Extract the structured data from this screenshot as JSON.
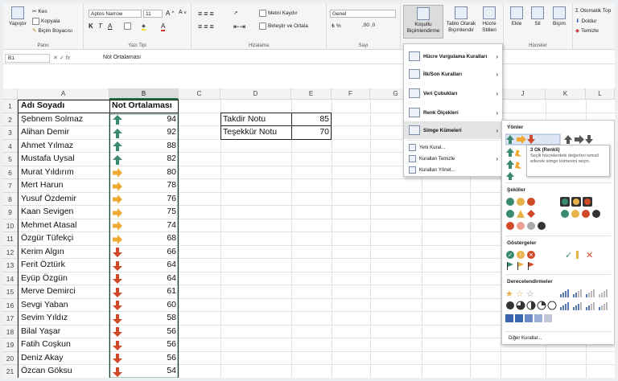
{
  "ribbon": {
    "clipboard": {
      "paste": "Yapıştır",
      "cut": "Kes",
      "copy": "Kopyala",
      "format_painter": "Biçim Boyacısı",
      "label": "Pano"
    },
    "font": {
      "name": "Aptos Narrow",
      "size": "11",
      "label": "Yazı Tipi",
      "bold": "K",
      "italic": "T",
      "underline": "A"
    },
    "alignment": {
      "wrap": "Metni Kaydır",
      "merge": "Birleştir ve Ortala",
      "label": "Hizalama"
    },
    "number": {
      "format": "Genel",
      "label": "Sayı"
    },
    "styles": {
      "conditional": "Koşullu Biçimlendirme",
      "table": "Tablo Olarak Biçimlendir",
      "cell": "Hücre Stilleri"
    },
    "cells": {
      "insert": "Ekle",
      "delete": "Sil",
      "format": "Biçim",
      "label": "Hücreler"
    },
    "editing": {
      "autosum": "Otomatik Top",
      "fill": "Doldur",
      "clear": "Temizle"
    }
  },
  "formula_bar": {
    "name_box": "B1",
    "fx": "fx",
    "content": "Not Ortalaması"
  },
  "columns": [
    "A",
    "B",
    "C",
    "D",
    "E",
    "F",
    "G",
    "H",
    "I",
    "J",
    "K",
    "L"
  ],
  "rows": [
    "1",
    "2",
    "3",
    "4",
    "5",
    "6",
    "7",
    "8",
    "9",
    "10",
    "11",
    "12",
    "13",
    "14",
    "15",
    "16",
    "17",
    "18",
    "19",
    "20",
    "21"
  ],
  "headers": {
    "name": "Adı Soyadı",
    "grade": "Not Ortalaması"
  },
  "students": [
    {
      "name": "Şebnem Solmaz",
      "grade": 94,
      "icon": "up"
    },
    {
      "name": "Alihan Demir",
      "grade": 92,
      "icon": "up"
    },
    {
      "name": "Ahmet Yılmaz",
      "grade": 88,
      "icon": "up"
    },
    {
      "name": "Mustafa Uysal",
      "grade": 82,
      "icon": "up"
    },
    {
      "name": "Murat Yıldırım",
      "grade": 80,
      "icon": "right"
    },
    {
      "name": "Mert Harun",
      "grade": 78,
      "icon": "right"
    },
    {
      "name": "Yusuf Özdemir",
      "grade": 76,
      "icon": "right"
    },
    {
      "name": "Kaan Sevigen",
      "grade": 75,
      "icon": "right"
    },
    {
      "name": "Mehmet Atasal",
      "grade": 74,
      "icon": "right"
    },
    {
      "name": "Özgür Tüfekçi",
      "grade": 68,
      "icon": "right"
    },
    {
      "name": "Kerim Algın",
      "grade": 66,
      "icon": "down"
    },
    {
      "name": "Ferit Öztürk",
      "grade": 64,
      "icon": "down"
    },
    {
      "name": "Eyüp Özgün",
      "grade": 64,
      "icon": "down"
    },
    {
      "name": "Merve Demirci",
      "grade": 61,
      "icon": "down"
    },
    {
      "name": "Sevgi Yaban",
      "grade": 60,
      "icon": "down"
    },
    {
      "name": "Sevim Yıldız",
      "grade": 58,
      "icon": "down"
    },
    {
      "name": "Bilal Yaşar",
      "grade": 56,
      "icon": "down"
    },
    {
      "name": "Fatih Coşkun",
      "grade": 56,
      "icon": "down"
    },
    {
      "name": "Deniz Akay",
      "grade": 56,
      "icon": "down"
    },
    {
      "name": "Özcan Göksu",
      "grade": 54,
      "icon": "down"
    }
  ],
  "thresholds": [
    {
      "label": "Takdir Notu",
      "value": 85
    },
    {
      "label": "Teşekkür Notu",
      "value": 70
    }
  ],
  "menu": {
    "highlight": "Hücre Vurgulama Kuralları",
    "topbottom": "İlk/Son Kuralları",
    "databars": "Veri Çubukları",
    "colorscales": "Renk Ölçekleri",
    "iconsets": "Simge Kümeleri",
    "newrule": "Yeni Kural...",
    "clearrules": "Kuralları Temizle",
    "managerules": "Kuralları Yönet..."
  },
  "submenu": {
    "directions": "Yönler",
    "shapes": "Şekiller",
    "indicators": "Göstergeler",
    "ratings": "Derecelendirmeler",
    "more": "Diğer Kurallar..."
  },
  "tooltip": {
    "title": "3 Ok (Renkli)",
    "body": "Seçili hücrelerdeki değerleri temsil edecek simge kümesini seçin."
  },
  "colors": {
    "up": "#3a8a6e",
    "right": "#f0a830",
    "down": "#d04a2a",
    "selection": "#217346"
  }
}
